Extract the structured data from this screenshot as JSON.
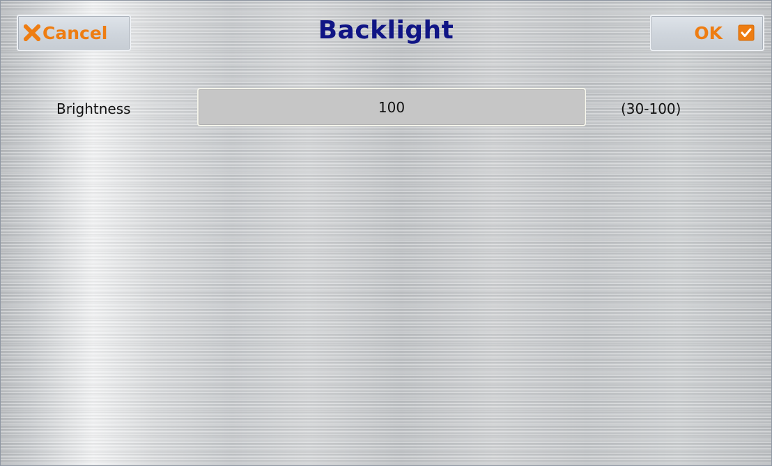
{
  "header": {
    "title": "Backlight",
    "cancel_label": "Cancel",
    "ok_label": "OK"
  },
  "icons": {
    "cancel": "close-x-icon",
    "ok": "checkbox-checked-icon"
  },
  "colors": {
    "button_text": "#ee7d12",
    "title": "#101585",
    "icon_orange": "#ee7d12"
  },
  "settings": {
    "brightness": {
      "label": "Brightness",
      "value": "100",
      "range": "(30-100)"
    }
  }
}
